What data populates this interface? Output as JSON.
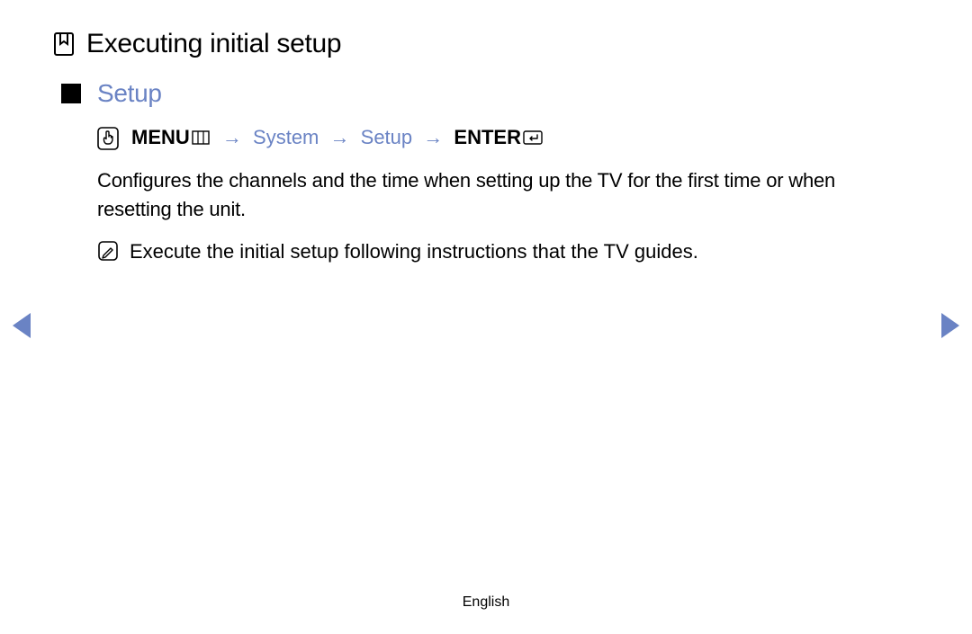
{
  "title": "Executing initial setup",
  "section": {
    "heading": "Setup"
  },
  "navpath": {
    "menu": "MENU",
    "system": "System",
    "setup": "Setup",
    "enter": "ENTER",
    "arrow": "→"
  },
  "body": {
    "description": "Configures the channels and the time when setting up the TV for the first time or when resetting the unit.",
    "note": "Execute the initial setup following instructions that the TV guides."
  },
  "footer": {
    "language": "English"
  }
}
